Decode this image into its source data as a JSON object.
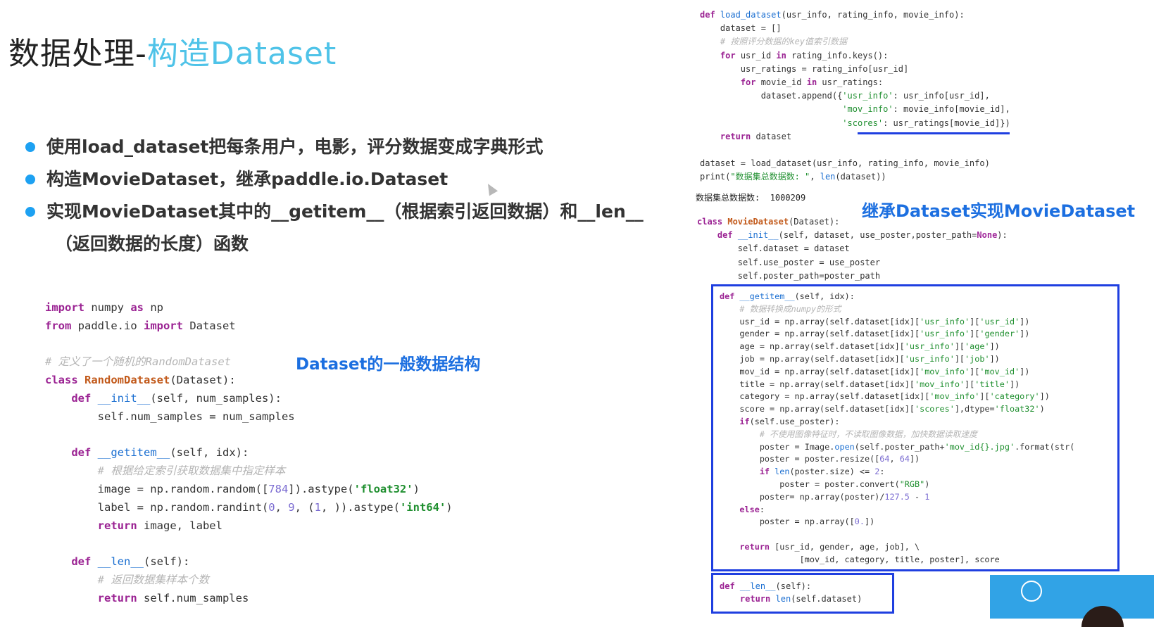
{
  "title": {
    "prefix": "数据处理-",
    "accent": "构造Dataset"
  },
  "bullets": [
    "使用load_dataset把每条用户，电影，评分数据变成字典形式",
    "构造MovieDataset，继承paddle.io.Dataset",
    "实现MovieDataset其中的__getitem__（根据索引返回数据）和__len__",
    "（返回数据的长度）函数"
  ],
  "labels": {
    "dataset_structure": "Dataset的一般数据结构",
    "movie_dataset": "继承Dataset实现MovieDataset"
  },
  "output": {
    "label": "数据集总数据数:",
    "value": "1000209"
  },
  "icons": {
    "video_play": "circle-icon",
    "presenter": "avatar"
  },
  "colors": {
    "accent": "#4fc3e8",
    "bullet": "#1da1f2",
    "box": "#1f3fe0",
    "label": "#1c6fe0"
  }
}
